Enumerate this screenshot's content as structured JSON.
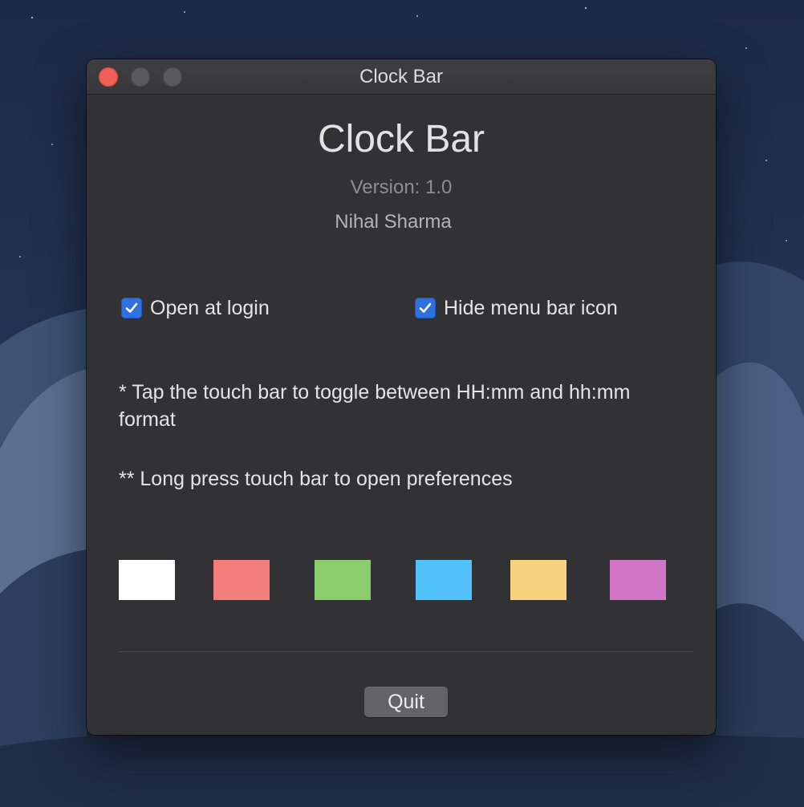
{
  "window": {
    "title": "Clock Bar"
  },
  "about": {
    "app_name": "Clock Bar",
    "version": "Version: 1.0",
    "author": "Nihal Sharma"
  },
  "options": {
    "open_at_login": {
      "label": "Open at login",
      "checked": true
    },
    "hide_menu_bar_icon": {
      "label": "Hide menu bar icon",
      "checked": true
    }
  },
  "notes": {
    "tap": "* Tap the touch bar to toggle between HH:mm and hh:mm format",
    "long_press": "** Long press touch bar to open preferences"
  },
  "color_swatches": [
    {
      "name": "white",
      "color": "#ffffff"
    },
    {
      "name": "red",
      "color": "#f27e7b"
    },
    {
      "name": "green",
      "color": "#8bcd6d"
    },
    {
      "name": "blue",
      "color": "#52c2fb"
    },
    {
      "name": "yellow",
      "color": "#f9d27f"
    },
    {
      "name": "purple",
      "color": "#d275c5"
    }
  ],
  "buttons": {
    "quit": "Quit"
  },
  "colors": {
    "window_bg": "#323234",
    "checkbox_accent": "#2f6fdf",
    "close_button": "#ee5f57"
  }
}
